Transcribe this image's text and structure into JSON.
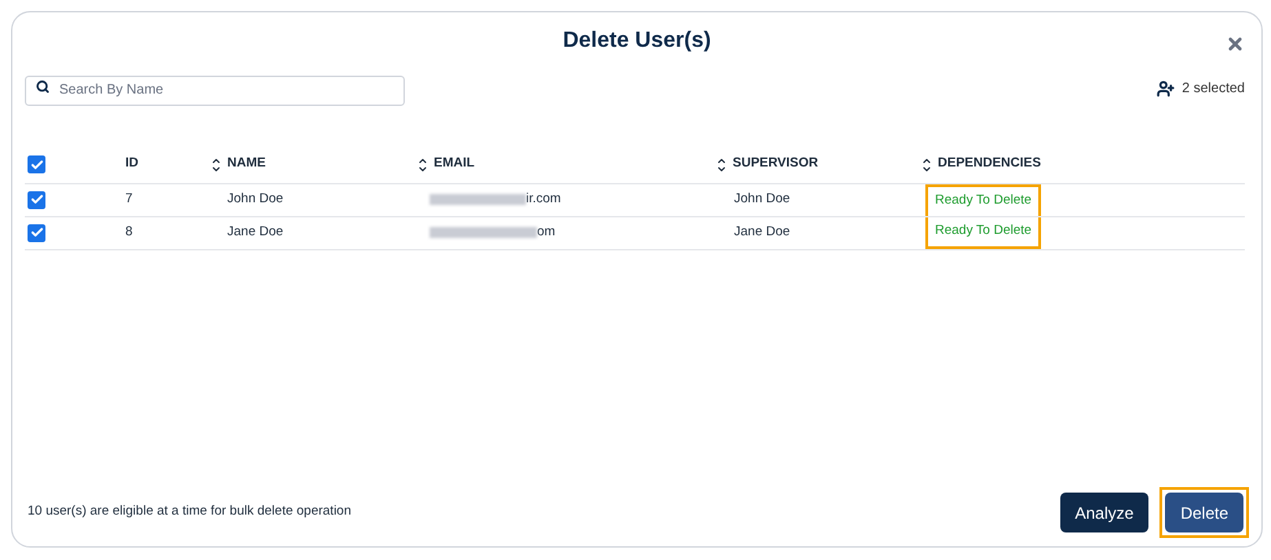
{
  "dialog": {
    "title": "Delete User(s)"
  },
  "search": {
    "placeholder": "Search By Name"
  },
  "selection_count": "2 selected",
  "table": {
    "select_all": {
      "checked": true
    },
    "columns": [
      {
        "label": "ID",
        "sortable": false
      },
      {
        "label": "NAME",
        "sortable": true
      },
      {
        "label": "EMAIL",
        "sortable": true
      },
      {
        "label": "SUPERVISOR",
        "sortable": true
      },
      {
        "label": "DEPENDENCIES",
        "sortable": true
      }
    ],
    "rows": [
      {
        "checked": true,
        "id": "7",
        "name": "John Doe",
        "email": "ir.com",
        "supervisor": "John Doe",
        "dependencies": "Ready To Delete",
        "highlighted": true
      },
      {
        "checked": true,
        "id": "8",
        "name": "Jane Doe",
        "email": "om",
        "supervisor": "Jane Doe",
        "dependencies": "Ready To Delete",
        "highlighted": true
      }
    ]
  },
  "footer_note": "10 user(s) are eligible at a time for bulk delete operation",
  "buttons": [
    {
      "label": "Analyze",
      "kind": "secondary",
      "highlighted": false
    },
    {
      "label": "Delete",
      "kind": "primary",
      "highlighted": true
    }
  ]
}
